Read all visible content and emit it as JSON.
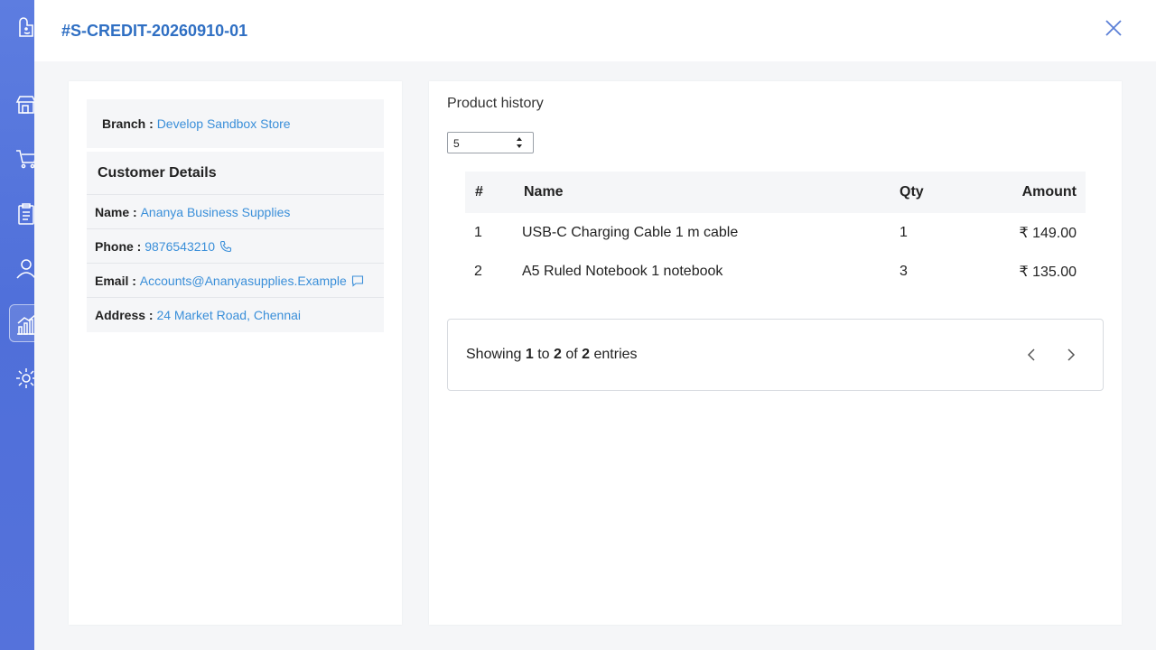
{
  "sidebar": {
    "items": [
      {
        "icon": "logo-icon"
      },
      {
        "icon": "store-icon"
      },
      {
        "icon": "cart-icon"
      },
      {
        "icon": "clipboard-icon"
      },
      {
        "icon": "user-icon"
      },
      {
        "icon": "chart-icon",
        "active": true
      },
      {
        "icon": "gear-icon"
      }
    ]
  },
  "modal": {
    "title": "#S-CREDIT-20260910-01",
    "close_icon": "close-icon"
  },
  "branch": {
    "label": "Branch : ",
    "value": "Develop Sandbox Store"
  },
  "customer": {
    "title": "Customer Details",
    "name_label": "Name : ",
    "name_value": "Ananya Business Supplies",
    "phone_label": "Phone : ",
    "phone_value": "9876543210",
    "email_label": "Email : ",
    "email_value": "Accounts@Ananyasupplies.Example",
    "address_label": "Address : ",
    "address_value": "24 Market Road, Chennai"
  },
  "product_history": {
    "title": "Product history",
    "page_size": "5",
    "columns": [
      "#",
      "Name",
      "Qty",
      "Amount"
    ],
    "rows": [
      {
        "num": "1",
        "name": "USB-C Charging Cable 1 m cable",
        "qty": "1",
        "amount": "₹ 149.00"
      },
      {
        "num": "2",
        "name": "A5 Ruled Notebook 1 notebook",
        "qty": "3",
        "amount": "₹ 135.00"
      }
    ],
    "footer": {
      "showing": "Showing",
      "from": "1",
      "to_word": "to",
      "to": "2",
      "of_word": "of",
      "total": "2",
      "entries": "entries"
    }
  },
  "colors": {
    "accent": "#2f6fc3",
    "link": "#3a8fd9",
    "sidebar": "#5572db"
  }
}
